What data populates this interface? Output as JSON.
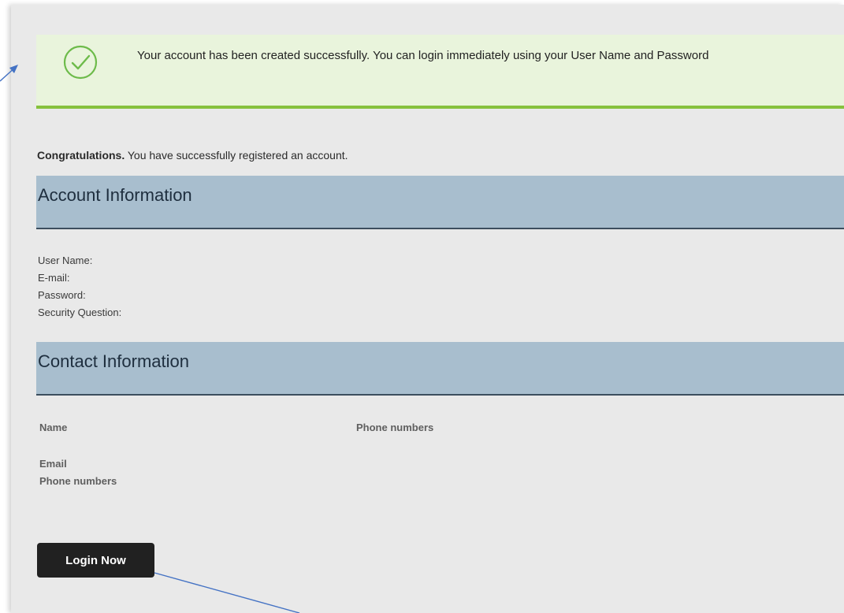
{
  "banner": {
    "message": "Your account has been created successfully.  You can login immediately using your User Name and Password",
    "accent_color": "#86c13d",
    "icon": "check-circle-icon"
  },
  "intro": {
    "bold": "Congratulations.",
    "text": " You have successfully registered an account."
  },
  "account_section": {
    "title": "Account Information",
    "fields": {
      "user_name": "User Name:",
      "email": "E-mail:",
      "password": "Password:",
      "security_question": "Security Question:"
    }
  },
  "contact_section": {
    "title": "Contact Information",
    "labels": {
      "name": "Name",
      "phone_numbers_right": "Phone numbers",
      "email": "Email",
      "phone_numbers": "Phone numbers"
    }
  },
  "login_button": {
    "label": "Login Now"
  },
  "colors": {
    "section_header": "#a8bece",
    "banner_background": "#e9f4dc",
    "annotation_arrow": "#4472c4"
  }
}
